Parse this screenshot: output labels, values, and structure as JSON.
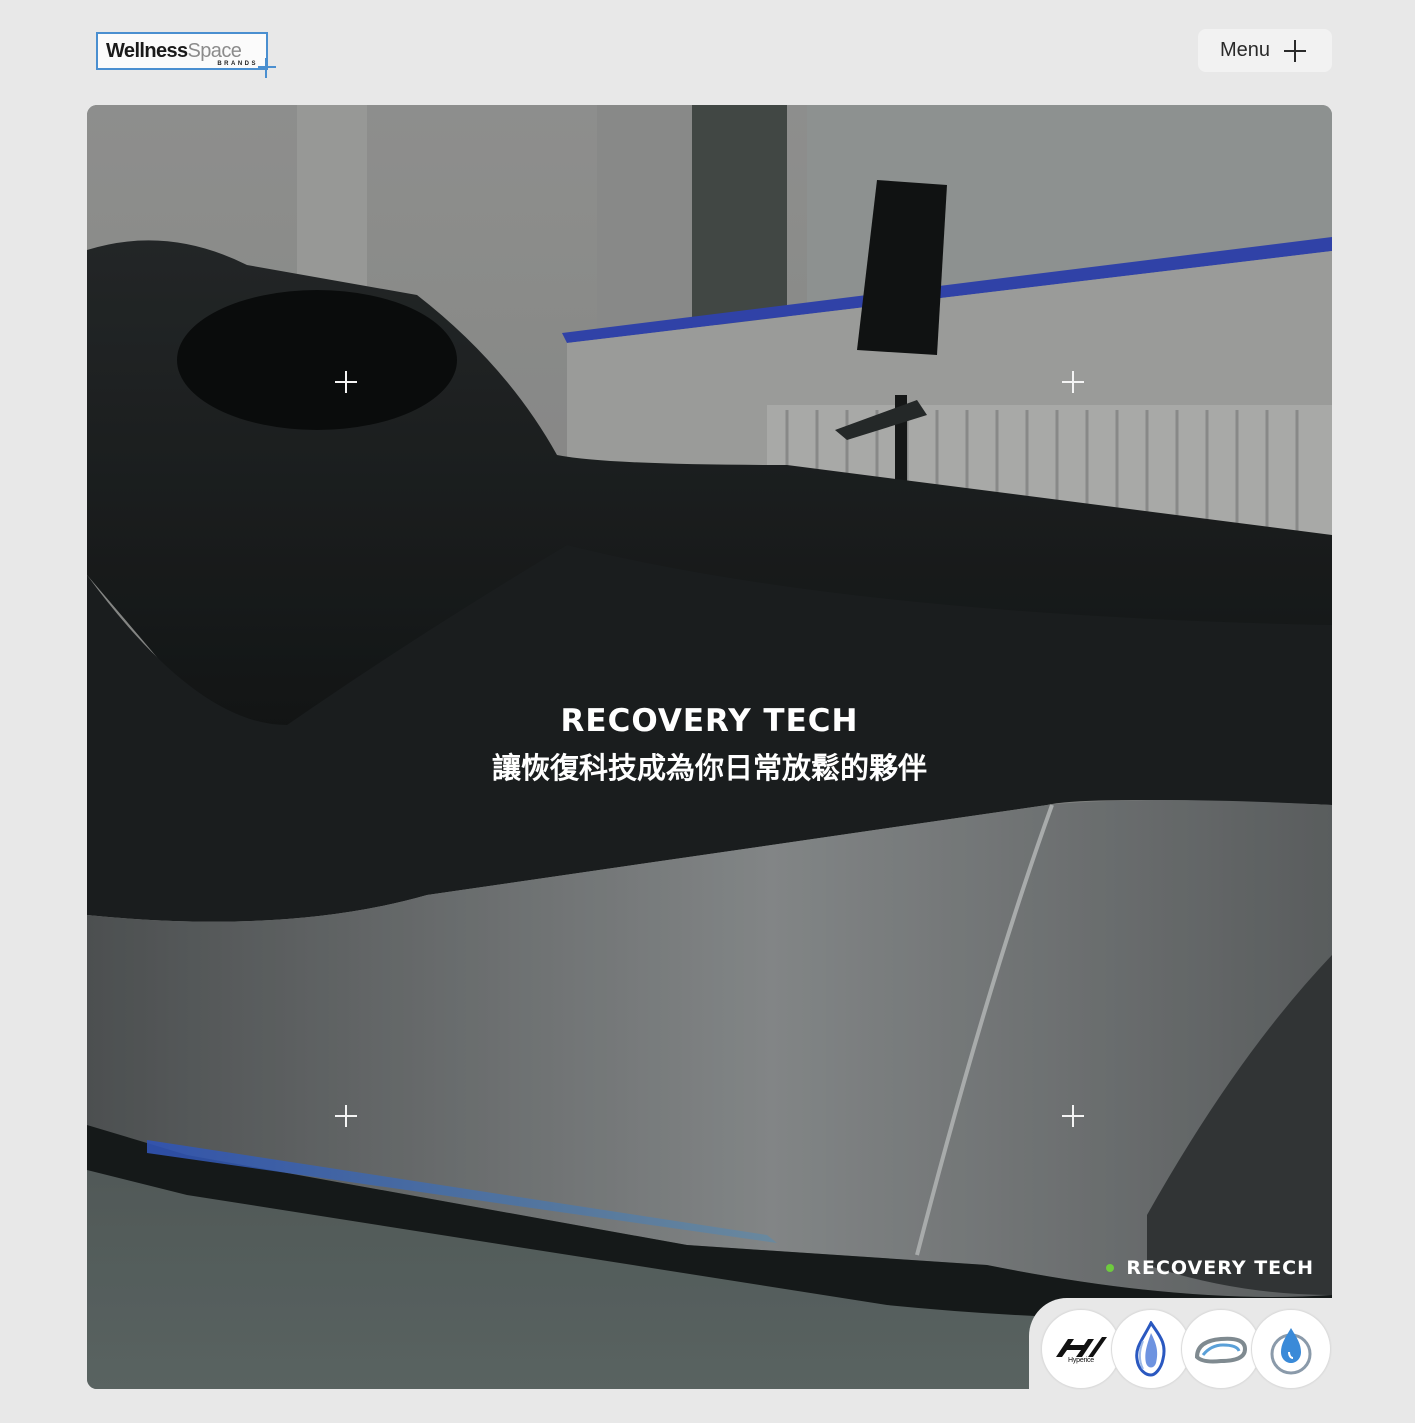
{
  "header": {
    "logo_main": "Wellness",
    "logo_accent": "Space",
    "logo_sub": "BRANDS",
    "menu_label": "Menu",
    "menu_icon": "plus-icon"
  },
  "hero": {
    "title": "RECOVERY TECH",
    "subtitle": "讓恢復科技成為你日常放鬆的夥伴",
    "tag_label": "RECOVERY TECH",
    "tag_dot_color": "#6ecb3e",
    "corner_markers": [
      "crosshair-icon",
      "crosshair-icon",
      "crosshair-icon",
      "crosshair-icon"
    ]
  },
  "brands": [
    {
      "name": "Hyperice",
      "icon": "hyperice-logo-icon",
      "label": "Hyperice"
    },
    {
      "name": "flame",
      "icon": "flame-logo-icon"
    },
    {
      "name": "pod",
      "icon": "pod-logo-icon"
    },
    {
      "name": "drop",
      "icon": "water-drop-logo-icon"
    }
  ],
  "colors": {
    "background": "#e8e8e8",
    "logo_border": "#4a8fd0",
    "accent_blue": "#3a6fd0"
  }
}
